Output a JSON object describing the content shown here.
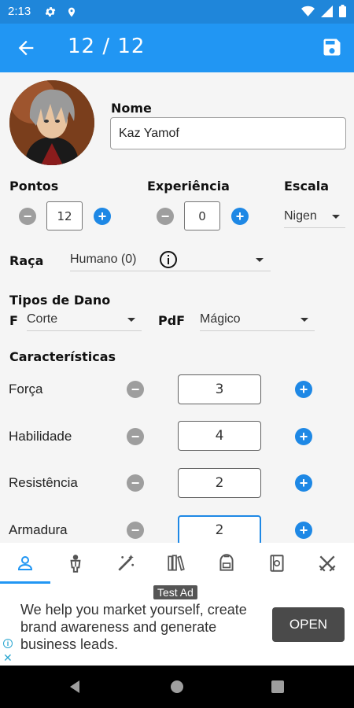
{
  "status_bar": {
    "time": "2:13"
  },
  "app_bar": {
    "title": "12 / 12"
  },
  "character": {
    "name_label": "Nome",
    "name_value": "Kaz Yamof",
    "points_label": "Pontos",
    "points_value": "12",
    "experience_label": "Experiência",
    "experience_value": "0",
    "scale_label": "Escala",
    "scale_value": "Nigen",
    "race_label": "Raça",
    "race_value": "Humano (0)",
    "damage_types_label": "Tipos de Dano",
    "f_label": "F",
    "f_value": "Corte",
    "pdf_label": "PdF",
    "pdf_value": "Mágico",
    "characteristics_label": "Características"
  },
  "stats": [
    {
      "label": "Força",
      "value": "3"
    },
    {
      "label": "Habilidade",
      "value": "4"
    },
    {
      "label": "Resistência",
      "value": "2"
    },
    {
      "label": "Armadura",
      "value": "2"
    }
  ],
  "tabs": [
    {
      "icon": "person-icon"
    },
    {
      "icon": "adventurer-icon"
    },
    {
      "icon": "magic-wand-icon"
    },
    {
      "icon": "books-icon"
    },
    {
      "icon": "backpack-icon"
    },
    {
      "icon": "spellbook-icon"
    },
    {
      "icon": "crossed-swords-icon"
    }
  ],
  "ad": {
    "label": "Test Ad",
    "text": "We help you market yourself, create brand awareness and generate business leads.",
    "button": "OPEN"
  },
  "colors": {
    "primary": "#2196f3",
    "status": "#1f86da",
    "plus": "#1e88e5",
    "minus": "#9e9e9e"
  }
}
